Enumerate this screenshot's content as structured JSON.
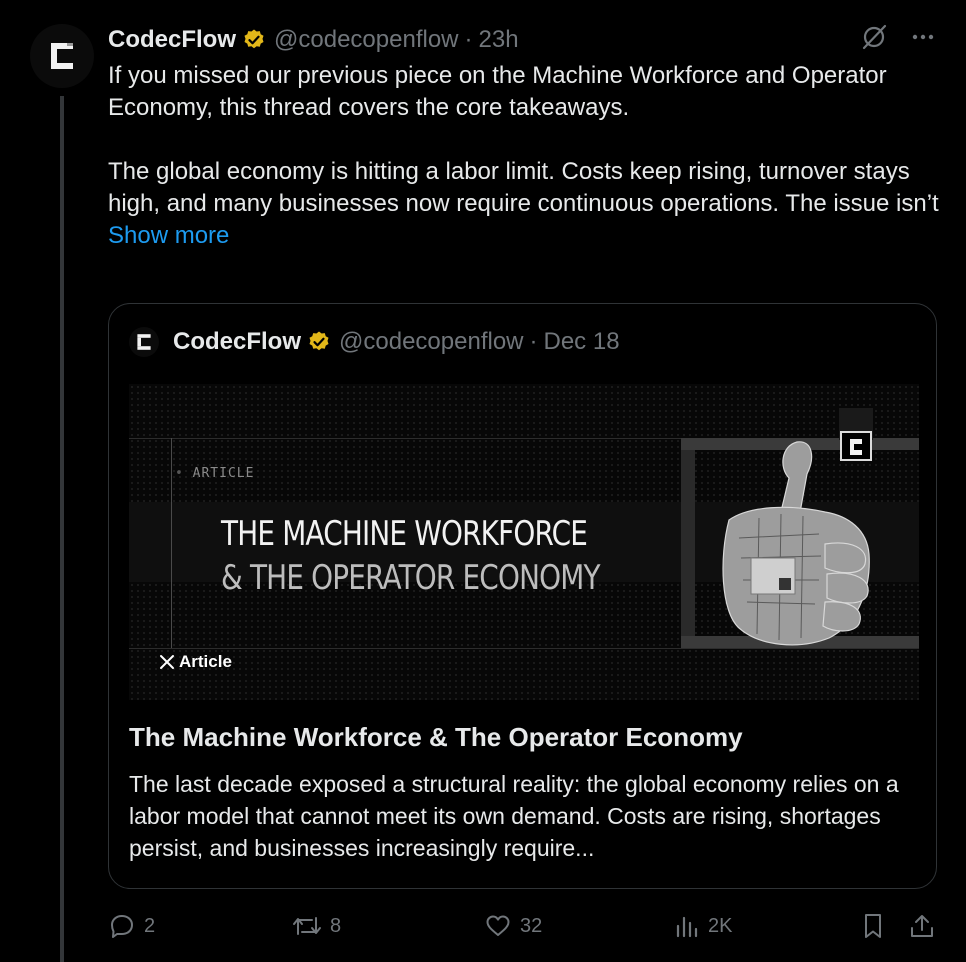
{
  "post": {
    "author_name": "CodecFlow",
    "handle": "@codecopenflow",
    "separator": "·",
    "time": "23h",
    "paragraphs": [
      "If you missed our previous piece on the Machine Workforce and Operator Economy, this thread covers the core takeaways.",
      "The global economy is hitting a labor limit. Costs keep rising, turnover stays high, and many businesses now require continuous operations. The issue isn’t"
    ],
    "show_more_label": "Show more"
  },
  "quote": {
    "author_name": "CodecFlow",
    "handle": "@codecopenflow",
    "separator": "·",
    "date": "Dec 18",
    "image": {
      "kicker": "ARTICLE",
      "headline_line1": "THE MACHINE WORKFORCE",
      "headline_line2": "& THE OPERATOR ECONOMY",
      "badge_label": "Article"
    },
    "article_title": "The Machine Workforce & The Operator Economy",
    "article_description": "The last decade exposed a structural reality: the global economy relies on a labor model that cannot meet its own demand. Costs are rising, shortages persist, and businesses increasingly require..."
  },
  "actions": {
    "replies": "2",
    "reposts": "8",
    "likes": "32",
    "views": "2K"
  },
  "colors": {
    "background": "#000000",
    "text_primary": "#e7e9ea",
    "text_secondary": "#71767b",
    "link": "#1d9bf0",
    "border": "#2f3336",
    "verified_gold": "#e2b719"
  },
  "icons": {
    "verified": "verified-badge-icon",
    "grok": "grok-icon",
    "more": "more-icon",
    "reply": "reply-icon",
    "repost": "repost-icon",
    "like": "heart-icon",
    "views": "views-icon",
    "bookmark": "bookmark-icon",
    "share": "share-icon",
    "x_logo": "x-logo-icon"
  }
}
